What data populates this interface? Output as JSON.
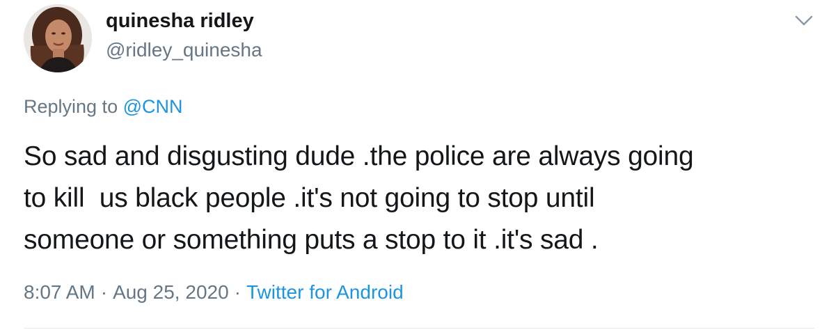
{
  "user": {
    "display_name": "quinesha ridley",
    "handle": "@ridley_quinesha",
    "avatar_icon": "profile-photo"
  },
  "reply": {
    "prefix": "Replying to ",
    "mention": "@CNN"
  },
  "tweet": {
    "text": "So sad and disgusting dude .the police are always going\nto kill  us black people .it's not going to stop until\nsomeone or something puts a stop to it .it's sad ."
  },
  "meta": {
    "time": "8:07 AM",
    "separator": "·",
    "date": "Aug 25, 2020",
    "source": "Twitter for Android"
  },
  "menu": {
    "icon": "chevron-down-icon"
  },
  "colors": {
    "text": "#14171a",
    "secondary": "#657786",
    "link": "#1b95e0",
    "divider": "#e1e8ed"
  }
}
